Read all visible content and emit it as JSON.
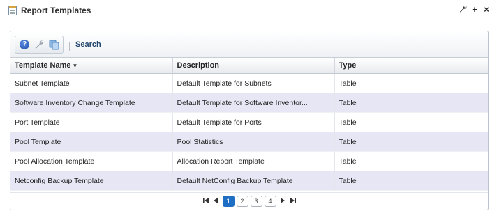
{
  "header": {
    "title": "Report Templates"
  },
  "window_controls": [
    {
      "name": "wrench-icon",
      "glyph": "🔧"
    },
    {
      "name": "plus-icon",
      "glyph": "+"
    },
    {
      "name": "close-icon",
      "glyph": "×"
    }
  ],
  "toolbar": {
    "icons": [
      "help-icon",
      "wrench-icon",
      "copy-icon"
    ],
    "search_label": "Search"
  },
  "table": {
    "columns": [
      "Template Name",
      "Description",
      "Type"
    ],
    "sorted_column": "Template Name",
    "rows": [
      [
        "Subnet Template",
        "Default Template for Subnets",
        "Table"
      ],
      [
        "Software Inventory Change Template",
        "Default Template for Software Inventor...",
        "Table"
      ],
      [
        "Port Template",
        "Default Template for Ports",
        "Table"
      ],
      [
        "Pool Template",
        "Pool Statistics",
        "Table"
      ],
      [
        "Pool Allocation Template",
        "Allocation Report Template",
        "Table"
      ],
      [
        "Netconfig Backup Template",
        "Default NetConfig Backup Template",
        "Table"
      ]
    ]
  },
  "pager": {
    "first": "⏮",
    "prev": "◀",
    "next": "▶",
    "last": "⏭",
    "pages": [
      "1",
      "2",
      "3",
      "4"
    ],
    "current_page": "1"
  },
  "colors": {
    "alt_row": "#e6e6f4",
    "active_page": "#1e6fc4",
    "link": "#23466e"
  }
}
